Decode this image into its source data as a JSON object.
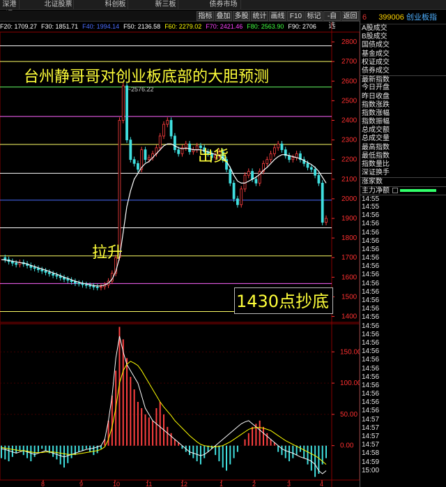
{
  "top_tabs": [
    {
      "label": "深港通",
      "left": 0,
      "width": 28
    },
    {
      "label": "北证股票",
      "left": 62,
      "width": 44
    },
    {
      "label": "科创板",
      "left": 148,
      "width": 36
    },
    {
      "label": "新三板",
      "left": 220,
      "width": 36
    },
    {
      "label": "债券市场",
      "left": 296,
      "width": 50
    }
  ],
  "back_label": "<",
  "toolbar": {
    "buttons": [
      "指标",
      "叠加",
      "多股",
      "统计",
      "画线",
      "F10",
      "标记",
      "-自选",
      "返回"
    ]
  },
  "ma_legend": [
    {
      "label": "F20: 1709.27",
      "color": "#ffffff"
    },
    {
      "label": "F30: 1851.71",
      "color": "#ffffff"
    },
    {
      "label": "F40: 1994.14",
      "color": "#4a6cff"
    },
    {
      "label": "F50: 2136.58",
      "color": "#ffffff"
    },
    {
      "label": "F60: 2279.02",
      "color": "#ffff00"
    },
    {
      "label": "F70: 2421.46",
      "color": "#ff40ff"
    },
    {
      "label": "F80: 2563.90",
      "color": "#40ff40"
    },
    {
      "label": "F90: 2706",
      "color": "#ffffff"
    }
  ],
  "right_panel": {
    "index_no": "6",
    "code": "399006",
    "name": "创业板指",
    "section1": [
      "A股成交",
      "B股成交",
      "国债成交",
      "基金成交",
      "权证成交",
      "债券成交"
    ],
    "section2": [
      "最新指数",
      "今日开盘",
      "昨日收盘",
      "指数涨跌",
      "指数涨幅",
      "指数振幅",
      "总成交额",
      "总成交量",
      "最高指数",
      "最低指数",
      "指数量比",
      "深证换手"
    ],
    "rise_label": "涨家数",
    "flow_label": "主力净额",
    "times": [
      "14:55",
      "14:55",
      "14:56",
      "14:56",
      "14:56",
      "14:56",
      "14:56",
      "14:56",
      "14:56",
      "14:56",
      "14:56",
      "14:56",
      "14:56",
      "14:56",
      "14:56",
      "14:56",
      "14:56",
      "14:56",
      "14:56",
      "14:56",
      "14:56",
      "14:56",
      "14:56",
      "14:56",
      "14:56",
      "14:56",
      "14:57",
      "14:57",
      "14:57",
      "14:57",
      "14:58",
      "14:59",
      "15:00"
    ]
  },
  "annotations": {
    "headline": "台州静哥哥对创业板底部的大胆预测",
    "sell": "出货",
    "rise": "拉升",
    "bottom": "1430点抄底"
  },
  "chart_data": {
    "type": "line",
    "main_axis": {
      "ticks": [
        2800,
        2700,
        2600,
        2500,
        2400,
        2300,
        2200,
        2100,
        2000,
        1900,
        1800,
        1700,
        1600,
        1500,
        1400
      ],
      "ylim": [
        1370,
        2850
      ]
    },
    "peak_label": "2576.22",
    "indicator_axis": {
      "ticks": [
        150.0,
        100.0,
        50.0,
        0.0
      ],
      "ylim": [
        -55,
        195
      ]
    },
    "x_ticks": [
      "8",
      "9",
      "10",
      "11",
      "12",
      "1",
      "2",
      "3",
      "4"
    ],
    "price_levels": [
      {
        "value": 2780,
        "color": "#ffffff"
      },
      {
        "value": 2700,
        "color": "#ffff66"
      },
      {
        "value": 2570,
        "color": "#66ff66"
      },
      {
        "value": 2420,
        "color": "#ff66ff"
      },
      {
        "value": 2277,
        "color": "#ffff66"
      },
      {
        "value": 2130,
        "color": "#ffffff"
      },
      {
        "value": 1993,
        "color": "#4a6cff"
      },
      {
        "value": 1852,
        "color": "#ffffff"
      },
      {
        "value": 1709,
        "color": "#ffff66"
      },
      {
        "value": 1568,
        "color": "#ff66ff"
      },
      {
        "value": 1425,
        "color": "#ffff66"
      }
    ],
    "price": [
      1700,
      1690,
      1680,
      1672,
      1665,
      1675,
      1668,
      1660,
      1650,
      1645,
      1638,
      1632,
      1625,
      1618,
      1610,
      1605,
      1598,
      1590,
      1585,
      1578,
      1570,
      1568,
      1562,
      1558,
      1555,
      1550,
      1548,
      1552,
      1560,
      1580,
      1620,
      1700,
      2400,
      2576,
      2300,
      2200,
      2180,
      2150,
      2250,
      2200,
      2210,
      2230,
      2260,
      2320,
      2380,
      2400,
      2320,
      2250,
      2230,
      2260,
      2280,
      2240,
      2250,
      2270,
      2260,
      2240,
      2230,
      2210,
      2220,
      2240,
      2200,
      2150,
      2080,
      2000,
      1970,
      2050,
      2120,
      2140,
      2100,
      2080,
      2140,
      2180,
      2200,
      2230,
      2260,
      2280,
      2250,
      2220,
      2200,
      2210,
      2230,
      2200,
      2180,
      2160,
      2150,
      2120,
      2080,
      1880,
      1900
    ],
    "price_ma": [
      1690,
      1688,
      1685,
      1682,
      1678,
      1675,
      1672,
      1668,
      1660,
      1655,
      1648,
      1642,
      1636,
      1630,
      1622,
      1615,
      1608,
      1600,
      1594,
      1587,
      1580,
      1575,
      1570,
      1566,
      1562,
      1558,
      1555,
      1556,
      1560,
      1570,
      1590,
      1630,
      1700,
      1830,
      1960,
      2040,
      2100,
      2130,
      2160,
      2180,
      2190,
      2210,
      2230,
      2250,
      2270,
      2280,
      2280,
      2270,
      2260,
      2255,
      2258,
      2255,
      2250,
      2250,
      2250,
      2245,
      2240,
      2232,
      2226,
      2220,
      2210,
      2190,
      2160,
      2120,
      2090,
      2080,
      2080,
      2090,
      2100,
      2110,
      2125,
      2145,
      2160,
      2180,
      2200,
      2215,
      2225,
      2225,
      2220,
      2215,
      2210,
      2205,
      2195,
      2185,
      2175,
      2160,
      2140,
      2110,
      2080
    ],
    "macd_hist": [
      -20,
      -22,
      -25,
      -18,
      -12,
      -8,
      -15,
      -20,
      -25,
      -18,
      -10,
      -5,
      -8,
      -12,
      -18,
      -22,
      -30,
      -35,
      -28,
      -20,
      -15,
      -10,
      -8,
      -5,
      -10,
      -15,
      -12,
      -5,
      10,
      40,
      80,
      120,
      190,
      170,
      140,
      110,
      90,
      70,
      60,
      50,
      45,
      40,
      60,
      70,
      50,
      30,
      20,
      10,
      5,
      -5,
      -10,
      -15,
      -20,
      -25,
      -30,
      -20,
      -10,
      -5,
      -15,
      -25,
      -35,
      -40,
      -30,
      -20,
      -10,
      0,
      10,
      20,
      30,
      35,
      40,
      30,
      20,
      10,
      5,
      -10,
      -15,
      -20,
      -25,
      -20,
      -15,
      -10,
      -20,
      -30,
      -40,
      -50,
      -45,
      -30,
      -20
    ],
    "dif": [
      -5,
      -6,
      -8,
      -10,
      -12,
      -10,
      -8,
      -10,
      -12,
      -14,
      -12,
      -10,
      -8,
      -10,
      -12,
      -14,
      -16,
      -18,
      -16,
      -14,
      -12,
      -10,
      -8,
      -6,
      -5,
      -4,
      -2,
      0,
      10,
      40,
      80,
      140,
      175,
      150,
      130,
      120,
      110,
      100,
      80,
      60,
      50,
      40,
      35,
      30,
      25,
      20,
      15,
      10,
      5,
      0,
      -5,
      -10,
      -12,
      -14,
      -16,
      -14,
      -10,
      -5,
      0,
      5,
      10,
      15,
      20,
      25,
      30,
      35,
      38,
      40,
      35,
      30,
      25,
      20,
      15,
      10,
      5,
      0,
      -5,
      -8,
      -10,
      -12,
      -15,
      -18,
      -20,
      -22,
      -25,
      -30,
      -40,
      -45,
      -40
    ],
    "dea": [
      -3,
      -4,
      -5,
      -6,
      -7,
      -8,
      -8,
      -9,
      -10,
      -11,
      -11,
      -11,
      -10,
      -10,
      -10,
      -11,
      -12,
      -13,
      -14,
      -14,
      -14,
      -13,
      -12,
      -11,
      -10,
      -9,
      -8,
      -6,
      -2,
      10,
      30,
      60,
      100,
      120,
      130,
      135,
      132,
      128,
      120,
      110,
      100,
      90,
      80,
      70,
      62,
      55,
      48,
      40,
      34,
      28,
      22,
      16,
      11,
      6,
      2,
      0,
      -1,
      -2,
      -2,
      -1,
      0,
      3,
      6,
      10,
      14,
      18,
      22,
      26,
      28,
      29,
      29,
      28,
      26,
      24,
      20,
      16,
      12,
      8,
      5,
      2,
      -1,
      -4,
      -7,
      -10,
      -13,
      -16,
      -20,
      -25,
      -30
    ]
  }
}
